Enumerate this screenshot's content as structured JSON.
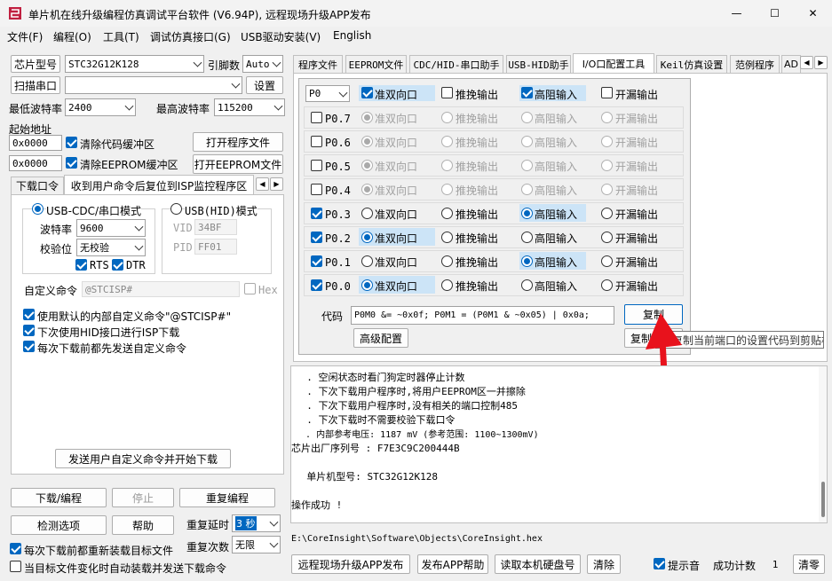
{
  "window": {
    "title": "单片机在线升级编程仿真调试平台软件 (V6.94P), 远程现场升级APP发布",
    "controls": [
      "—",
      "☐",
      "✕"
    ]
  },
  "menu": [
    "文件(F)",
    "编程(O)",
    "工具(T)",
    "调试仿真接口(G)",
    "USB驱动安装(V)",
    "English"
  ],
  "left": {
    "chip_type_label": "芯片型号",
    "chip_type_value": "STC32G12K128",
    "pin_count_label": "引脚数",
    "pin_count_value": "Auto",
    "scan_port_label": "扫描串口",
    "port_value": "",
    "settings_label": "设置",
    "min_baud_label": "最低波特率",
    "min_baud_value": "2400",
    "max_baud_label": "最高波特率",
    "max_baud_value": "115200",
    "start_addr_label": "起始地址",
    "addr1": "0x0000",
    "clear_code_label": "清除代码缓冲区",
    "open_prog_label": "打开程序文件",
    "addr2": "0x0000",
    "clear_eeprom_label": "清除EEPROM缓冲区",
    "open_eeprom_label": "打开EEPROM文件",
    "tabs": [
      "下载口令",
      "收到用户命令后复位到ISP监控程序区"
    ],
    "usb_cdc_label": "USB-CDC/串口模式",
    "usb_hid_label": "USB(HID)模式",
    "baud_label": "波特率",
    "baud_value": "9600",
    "parity_label": "校验位",
    "parity_value": "无校验",
    "vid_label": "VID",
    "vid_value": "34BF",
    "pid_label": "PID",
    "pid_value": "FF01",
    "rts_label": "RTS",
    "dtr_label": "DTR",
    "custom_cmd_label": "自定义命令",
    "custom_cmd_value": "@STCISP#",
    "hex_label": "Hex",
    "opt1": "使用默认的内部自定义命令\"@STCISP#\"",
    "opt2": "下次使用HID接口进行ISP下载",
    "opt3": "每次下载前都先发送自定义命令",
    "send_cmd_label": "发送用户自定义命令并开始下载",
    "download_label": "下载/编程",
    "stop_label": "停止",
    "reprogram_label": "重复编程",
    "check_label": "检测选项",
    "help_label": "帮助",
    "repeat_delay_label": "重复延时",
    "repeat_delay_value": "3 秒",
    "repeat_count_label": "重复次数",
    "repeat_count_value": "无限",
    "reload_label": "每次下载前都重新装载目标文件",
    "autoload_label": "当目标文件变化时自动装载并发送下载命令"
  },
  "right_tabs": [
    "程序文件",
    "EEPROM文件",
    "CDC/HID-串口助手",
    "USB-HID助手",
    "I/O口配置工具",
    "Keil仿真设置",
    "范例程序",
    "AD"
  ],
  "io": {
    "port_value": "P0",
    "header": [
      "准双向口",
      "推挽输出",
      "高阻输入",
      "开漏输出"
    ],
    "pins": [
      {
        "name": "P0.7",
        "checked": false,
        "mode": 0
      },
      {
        "name": "P0.6",
        "checked": false,
        "mode": 0
      },
      {
        "name": "P0.5",
        "checked": false,
        "mode": 0
      },
      {
        "name": "P0.4",
        "checked": false,
        "mode": 0
      },
      {
        "name": "P0.3",
        "checked": true,
        "mode": 2
      },
      {
        "name": "P0.2",
        "checked": true,
        "mode": 0
      },
      {
        "name": "P0.1",
        "checked": true,
        "mode": 2
      },
      {
        "name": "P0.0",
        "checked": true,
        "mode": 0
      }
    ],
    "code_label": "代码",
    "code_value": "P0M0 &= ~0x0f; P0M1 = (P0M1 & ~0x05) | 0x0a;",
    "copy_label": "复制",
    "adv_label": "高级配置",
    "copy2_label": "复制",
    "tooltip": "复制当前端口的设置代码到剪贴板"
  },
  "log": [
    "  . 空闲状态时看门狗定时器停止计数",
    "  . 下次下载用户程序时,将用户EEPROM区一并擦除",
    "  . 下次下载用户程序时,没有相关的端口控制485",
    "  . 下次下载时不需要校验下载口令",
    "  . 内部参考电压: 1187 mV (参考范围: 1100~1300mV)",
    "芯片出厂序列号 : F7E3C9C200444B",
    "",
    "  单片机型号: STC32G12K128",
    "",
    "操作成功 !"
  ],
  "file_path": "E:\\CoreInsight\\Software\\Objects\\CoreInsight.hex",
  "bottom": {
    "publish_label": "远程现场升级APP发布",
    "publish_help_label": "发布APP帮助",
    "read_disk_label": "读取本机硬盘号",
    "clear_label": "清除",
    "beep_label": "提示音",
    "success_label": "成功计数",
    "success_value": "1",
    "zero_label": "清零"
  },
  "colors": {
    "accent": "#0067c0",
    "highlight": "#cce4f7",
    "arrow": "#e8121c"
  }
}
